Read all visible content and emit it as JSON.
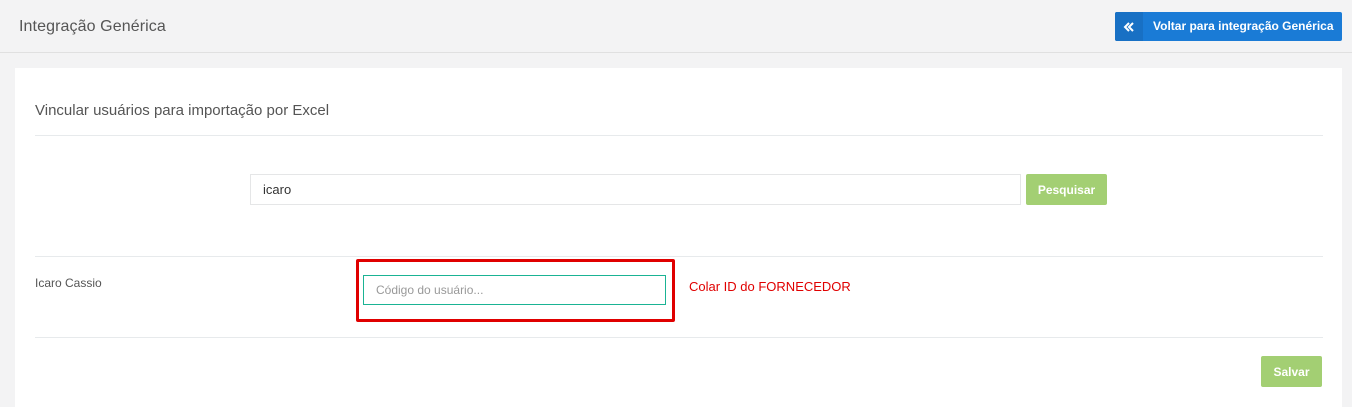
{
  "header": {
    "title": "Integração Genérica",
    "back_button_label": "Voltar para integração Genérica",
    "back_icon": "double-chevron-left-icon"
  },
  "panel": {
    "section_title": "Vincular usuários para importação por Excel",
    "search": {
      "value": "icaro",
      "button_label": "Pesquisar"
    },
    "results": [
      {
        "name": "Icaro Cassio",
        "code_placeholder": "Código do usuário...",
        "code_value": ""
      }
    ],
    "annotation_text": "Colar ID do FORNECEDOR",
    "save_label": "Salvar"
  },
  "colors": {
    "primary": "#1a7bd6",
    "success": "#a3cf73",
    "focus_border": "#1ab394",
    "annotation": "#e00000"
  }
}
